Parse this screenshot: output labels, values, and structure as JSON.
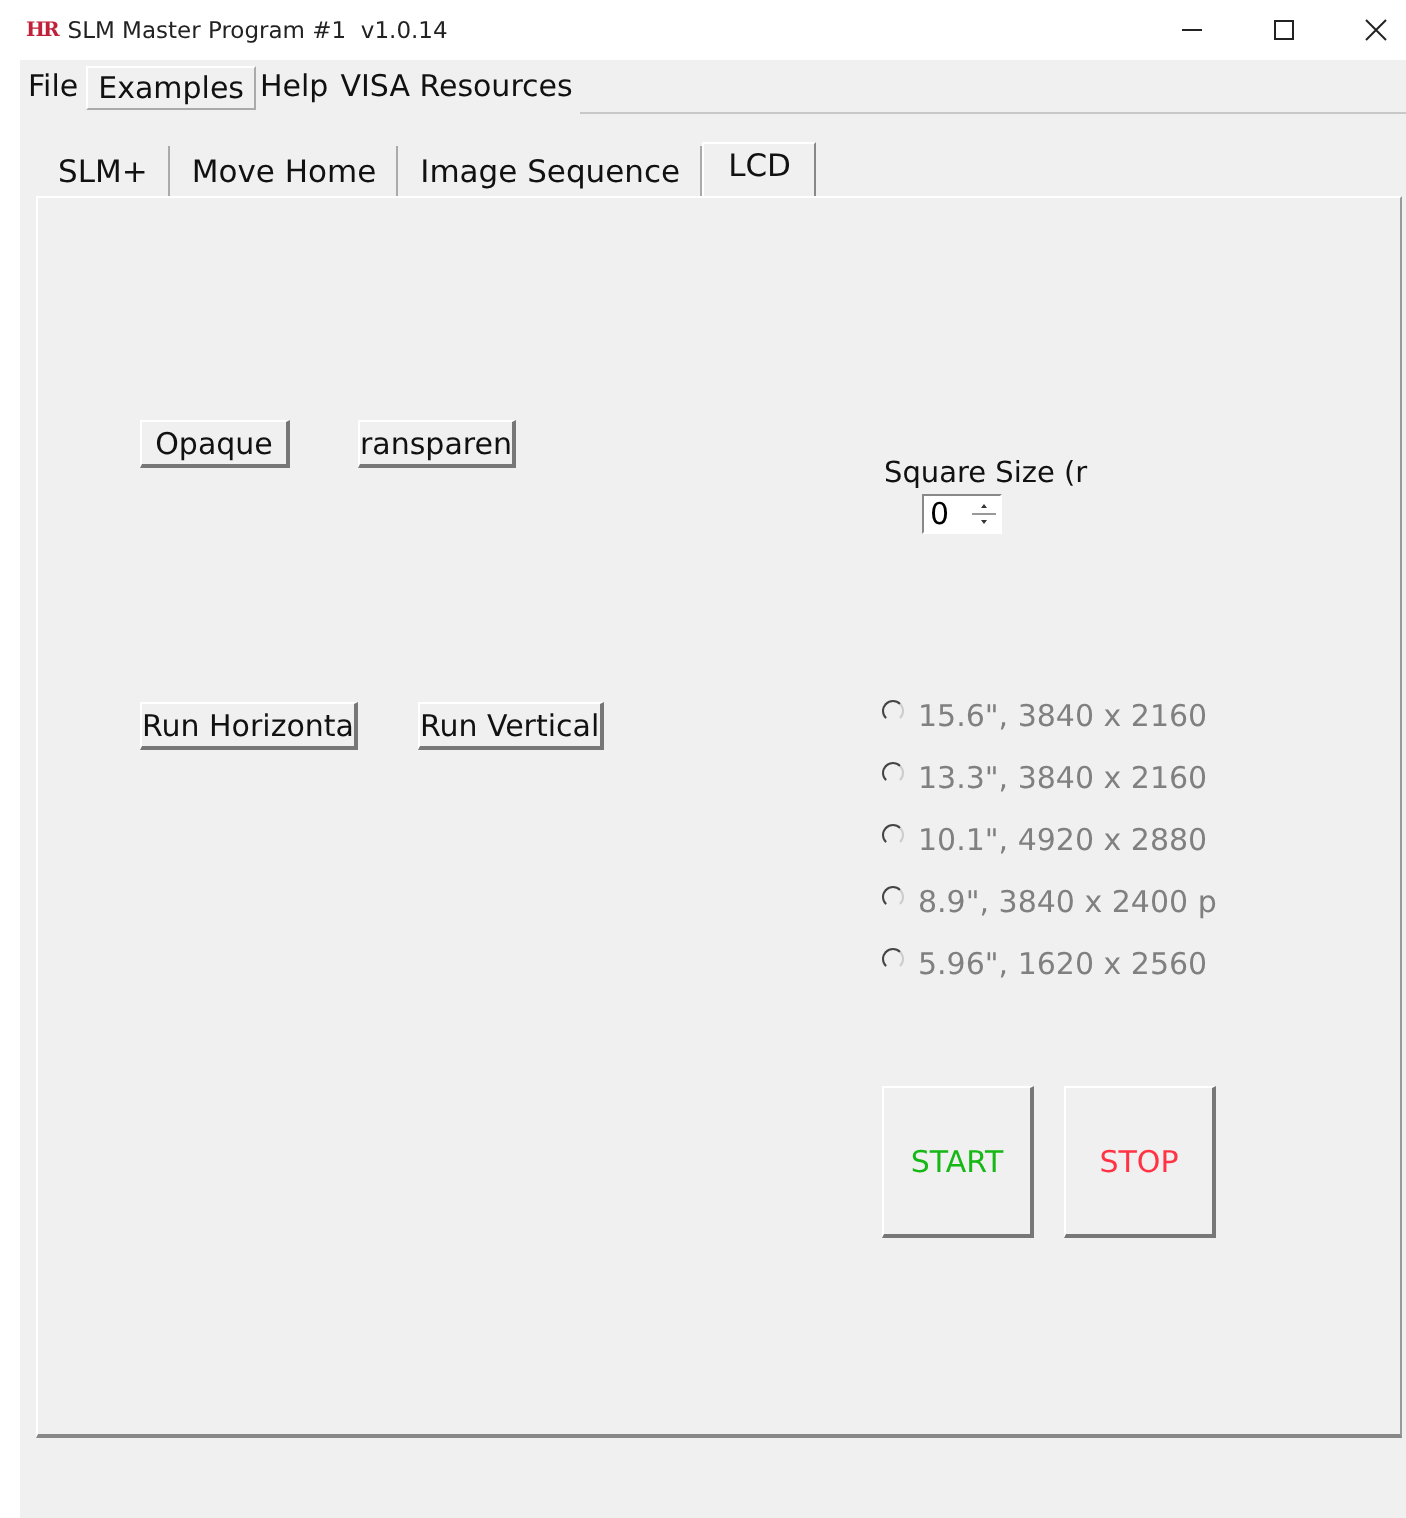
{
  "window": {
    "logo": "HR",
    "title": "SLM Master Program #1  v1.0.14"
  },
  "menu": [
    {
      "label": "File",
      "selected": false
    },
    {
      "label": "Examples",
      "selected": true
    },
    {
      "label": "Help",
      "selected": false
    },
    {
      "label": "VISA Resources",
      "selected": false
    }
  ],
  "tabs": [
    {
      "label": "SLM+",
      "selected": false
    },
    {
      "label": "Move Home",
      "selected": false
    },
    {
      "label": "Image Sequence",
      "selected": false
    },
    {
      "label": "LCD",
      "selected": true
    }
  ],
  "left_buttons": [
    [
      "Opaque",
      "ransparen"
    ],
    [
      "Run Horizonta",
      "Run Vertical"
    ]
  ],
  "square_size": {
    "label": "Square Size (r",
    "value": "0"
  },
  "displays": [
    {
      "label": "15.6\", 3840 x 2160",
      "selected": false,
      "disabled": true
    },
    {
      "label": "13.3\", 3840 x 2160",
      "selected": false,
      "disabled": true
    },
    {
      "label": "10.1\", 4920 x 2880",
      "selected": false,
      "disabled": true
    },
    {
      "label": "8.9\", 3840 x 2400 p",
      "selected": false,
      "disabled": true
    },
    {
      "label": "5.96\", 1620 x 2560",
      "selected": false,
      "disabled": true
    }
  ],
  "actions": [
    {
      "label": "START",
      "color": "#16b816"
    },
    {
      "label": "STOP",
      "color": "#ff3344"
    }
  ]
}
